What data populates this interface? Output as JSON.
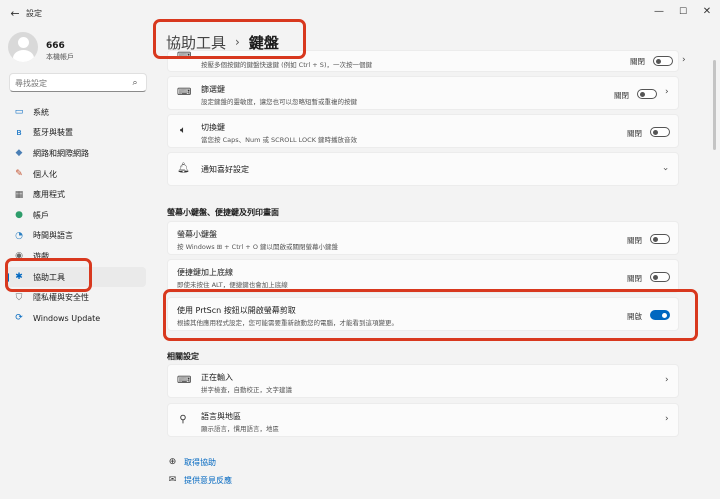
{
  "window": {
    "title": "設定",
    "back_glyph": "←",
    "minimize": "—",
    "maximize": "☐",
    "close": "✕"
  },
  "profile": {
    "name": "666",
    "subtitle": "本機帳戶"
  },
  "search": {
    "placeholder": "尋找設定",
    "icon": "search-icon"
  },
  "nav": [
    {
      "label": "系統",
      "icon": "system-icon",
      "glyph": "▭",
      "color": "#0067c0"
    },
    {
      "label": "藍牙與裝置",
      "icon": "bluetooth-icon",
      "glyph": "ʙ",
      "color": "#0067c0"
    },
    {
      "label": "網路和網際網路",
      "icon": "wifi-icon",
      "glyph": "◆",
      "color": "#4a7fb5"
    },
    {
      "label": "個人化",
      "icon": "brush-icon",
      "glyph": "✎",
      "color": "#c24e2a"
    },
    {
      "label": "應用程式",
      "icon": "apps-icon",
      "glyph": "▦",
      "color": "#555555"
    },
    {
      "label": "帳戶",
      "icon": "account-icon",
      "glyph": "●",
      "color": "#2e9d6b"
    },
    {
      "label": "時間與語言",
      "icon": "time-language-icon",
      "glyph": "◔",
      "color": "#2a7fc2"
    },
    {
      "label": "遊戲",
      "icon": "gaming-icon",
      "glyph": "◉",
      "color": "#666666"
    },
    {
      "label": "協助工具",
      "icon": "accessibility-icon",
      "glyph": "✱",
      "color": "#0067c0",
      "active": true
    },
    {
      "label": "隱私權與安全性",
      "icon": "privacy-icon",
      "glyph": "⛉",
      "color": "#666666"
    },
    {
      "label": "Windows Update",
      "icon": "windows-update-icon",
      "glyph": "⟳",
      "color": "#0067c0"
    }
  ],
  "header": {
    "crumb1": "協助工具",
    "separator": "›",
    "crumb2": "鍵盤"
  },
  "cards": {
    "sticky": {
      "desc": "按壓多個按鍵的鍵盤快速鍵 (例如 Ctrl + S)，一次按一個鍵",
      "state": "關閉",
      "icon": "keyboard-icon"
    },
    "filter": {
      "title": "篩選鍵",
      "desc": "設定鍵盤的靈敏度，讓您也可以忽略短暫或重複的按鍵",
      "state": "關閉",
      "icon": "filter-keys-icon"
    },
    "toggle_keys": {
      "title": "切換鍵",
      "desc": "當您按 Caps、Num 或 SCROLL LOCK 鍵時播放音效",
      "state": "關閉",
      "icon": "speaker-icon"
    },
    "notify": {
      "title": "通知喜好設定",
      "icon": "bell-icon"
    }
  },
  "section1": "螢幕小鍵盤、便捷鍵及列印畫面",
  "cards2": {
    "osk": {
      "title": "螢幕小鍵盤",
      "desc": "按 Windows ⊞ + Ctrl + O 鍵以開啟或關閉螢幕小鍵盤",
      "state": "關閉"
    },
    "underline": {
      "title": "便捷鍵加上底線",
      "desc": "即使未按住 ALT，便捷鍵也會加上底線",
      "state": "關閉"
    },
    "prtscn": {
      "title": "使用 PrtScn 按鈕以開啟螢幕剪取",
      "desc": "根據其他應用程式設定，您可能需要重新啟動您的電腦，才能看到這項變更。",
      "state": "開啟"
    }
  },
  "section2": "相關設定",
  "related": {
    "typing": {
      "title": "正在輸入",
      "desc": "拼字檢查，自動校正，文字建議",
      "icon": "keyboard-icon"
    },
    "language": {
      "title": "語言與地區",
      "desc": "顯示語言，慣用語言，地區",
      "icon": "language-region-icon"
    }
  },
  "links": {
    "help": {
      "label": "取得協助",
      "icon": "help-icon"
    },
    "feedback": {
      "label": "提供意見反應",
      "icon": "feedback-icon"
    }
  },
  "colors": {
    "accent": "#0067c0",
    "highlight": "#d8381e"
  }
}
